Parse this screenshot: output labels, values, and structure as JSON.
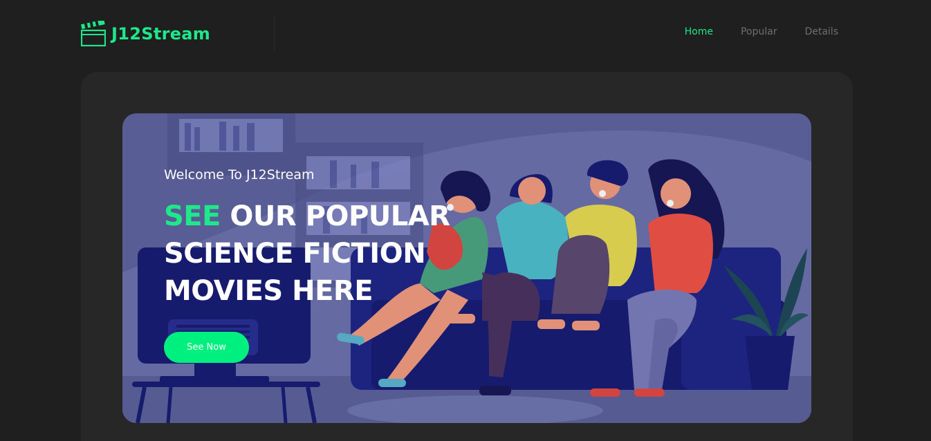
{
  "brand": {
    "name": "J12Stream",
    "accent_color": "#1ee88a",
    "icon": "clapperboard-icon"
  },
  "nav": {
    "items": [
      {
        "label": "Home",
        "active": true
      },
      {
        "label": "Popular",
        "active": false
      },
      {
        "label": "Details",
        "active": false
      }
    ]
  },
  "hero": {
    "welcome": "Welcome To J12Stream",
    "headline_accent": "SEE",
    "headline_rest": "OUR POPULAR SCIENCE FICTION MOVIES HERE",
    "button_label": "See Now",
    "button_color": "#00f07f",
    "illustration": "friends-watching-tv-illustration"
  }
}
